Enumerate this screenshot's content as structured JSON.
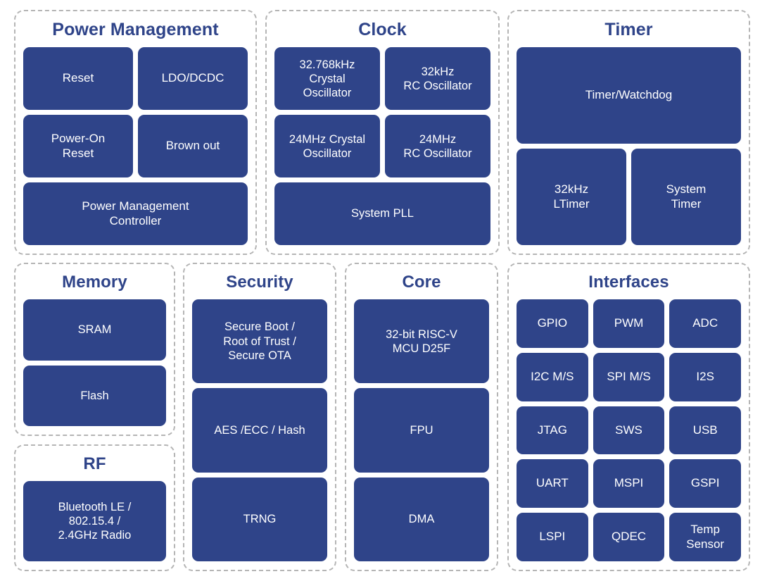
{
  "colors": {
    "block_fill": "#2F4489",
    "block_text": "#FFFFFF",
    "title_text": "#2F4489",
    "panel_border": "#B5B5B5",
    "background": "#FFFFFF"
  },
  "panels": {
    "power": {
      "title": "Power Management",
      "rows": [
        [
          "Reset",
          "LDO/DCDC"
        ],
        [
          "Power-On\nReset",
          "Brown out"
        ],
        [
          "Power Management\nController"
        ]
      ]
    },
    "clock": {
      "title": "Clock",
      "rows": [
        [
          "32.768kHz\nCrystal\nOscillator",
          "32kHz\nRC Oscillator"
        ],
        [
          "24MHz Crystal\nOscillator",
          "24MHz\nRC Oscillator"
        ],
        [
          "System PLL"
        ]
      ]
    },
    "timer": {
      "title": "Timer",
      "rows": [
        [
          "Timer/Watchdog"
        ],
        [
          "32kHz\nLTimer",
          "System\nTimer"
        ]
      ]
    },
    "memory": {
      "title": "Memory",
      "rows": [
        [
          "SRAM"
        ],
        [
          "Flash"
        ]
      ]
    },
    "rf": {
      "title": "RF",
      "rows": [
        [
          "Bluetooth LE /\n802.15.4 /\n2.4GHz Radio"
        ]
      ]
    },
    "security": {
      "title": "Security",
      "rows": [
        [
          "Secure Boot /\nRoot of Trust /\nSecure OTA"
        ],
        [
          "AES /ECC / Hash"
        ],
        [
          "TRNG"
        ]
      ]
    },
    "core": {
      "title": "Core",
      "rows": [
        [
          "32-bit RISC-V\nMCU D25F"
        ],
        [
          "FPU"
        ],
        [
          "DMA"
        ]
      ]
    },
    "interfaces": {
      "title": "Interfaces",
      "rows": [
        [
          "GPIO",
          "PWM",
          "ADC"
        ],
        [
          "I2C M/S",
          "SPI M/S",
          "I2S"
        ],
        [
          "JTAG",
          "SWS",
          "USB"
        ],
        [
          "UART",
          "MSPI",
          "GSPI"
        ],
        [
          "LSPI",
          "QDEC",
          "Temp\nSensor"
        ]
      ]
    }
  }
}
